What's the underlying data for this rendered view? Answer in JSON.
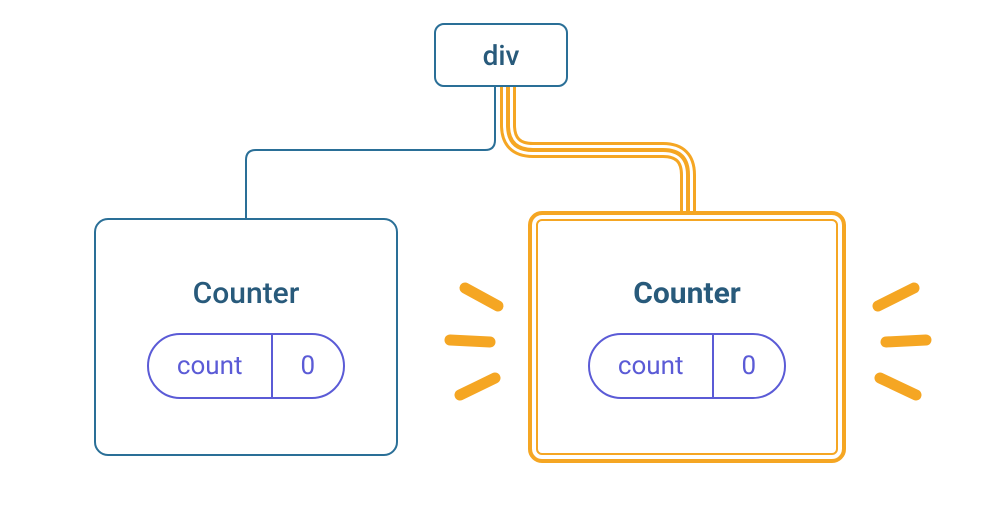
{
  "root": {
    "label": "div"
  },
  "left": {
    "title": "Counter",
    "pill_label": "count",
    "pill_value": "0"
  },
  "right": {
    "title": "Counter",
    "pill_label": "count",
    "pill_value": "0"
  },
  "colors": {
    "teal": "#2a6f97",
    "amber": "#f5a623",
    "white": "#ffffff",
    "indigo": "#5b5bd6"
  }
}
